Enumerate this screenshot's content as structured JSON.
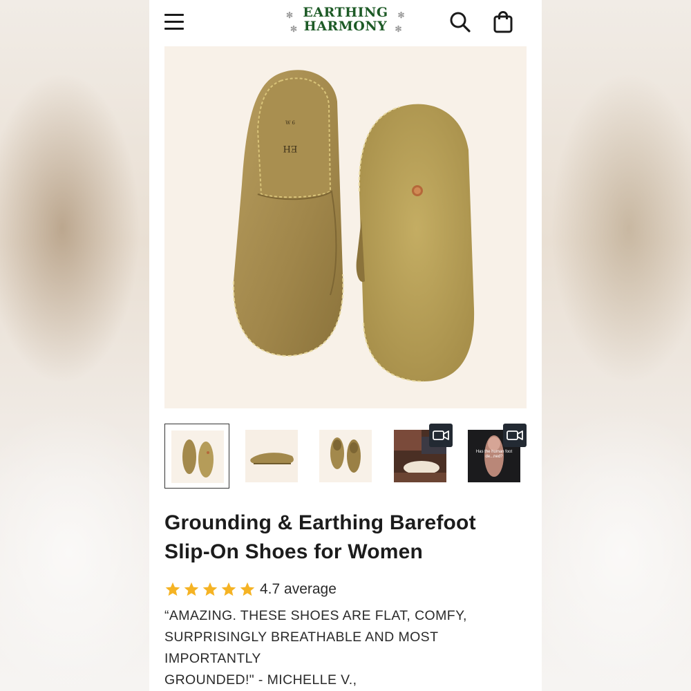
{
  "header": {
    "brand_line1": "EARTHING",
    "brand_line2": "HARMONY",
    "menu_icon": "hamburger-menu-icon",
    "search_icon": "search-icon",
    "cart_icon": "shopping-bag-icon"
  },
  "gallery": {
    "thumbnails": [
      {
        "type": "image",
        "active": true
      },
      {
        "type": "image",
        "active": false
      },
      {
        "type": "image",
        "active": false
      },
      {
        "type": "video",
        "active": false
      },
      {
        "type": "video",
        "active": false,
        "caption": "Has the human foot de...ned?"
      }
    ],
    "shoe_labels": {
      "size": "W 6",
      "mark": "EH"
    }
  },
  "product": {
    "title_line1": "Grounding & Earthing Barefoot",
    "title_line2": "Slip-On Shoes for Women",
    "rating_value": 4.7,
    "stars_filled": 5,
    "rating_text": "4.7 average",
    "quote_line1": "“AMAZING. THESE SHOES ARE FLAT, COMFY,",
    "quote_line2": "SURPRISINGLY BREATHABLE AND MOST IMPORTANTLY",
    "quote_line3": "GROUNDED!\" - MICHELLE V.,"
  },
  "colors": {
    "brand_green": "#1d5a26",
    "star_gold": "#f5b324",
    "hero_bg": "#f8f1e8",
    "shoe_leather": "#a38a4a"
  }
}
